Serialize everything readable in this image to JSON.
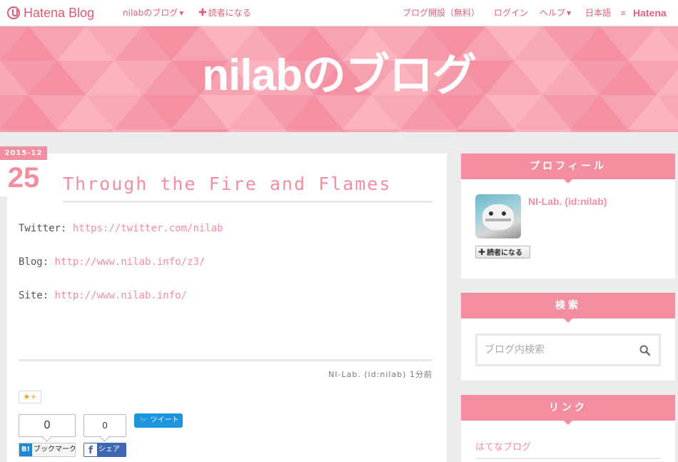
{
  "topbar": {
    "logo": "Hatena Blog",
    "blog_menu": "nilabのブログ",
    "subscribe": "読者になる",
    "start_blog": "ブログ開設（無料）",
    "login": "ログイン",
    "help": "ヘルプ",
    "language": "日本語",
    "hatena": "Hatena"
  },
  "header": {
    "blog_title": "nilabのブログ"
  },
  "entry": {
    "date_ym": "2015-12",
    "date_day": "25",
    "title": "Through the Fire and Flames",
    "lines": [
      {
        "label": "Twitter:",
        "url": "https://twitter.com/nilab"
      },
      {
        "label": "Blog:",
        "url": "http://www.nilab.info/z3/"
      },
      {
        "label": "Site:",
        "url": "http://www.nilab.info/"
      }
    ],
    "footer": "NI-Lab. (id:nilab) 1分前",
    "star_label": "★+",
    "hatebu_count": "0",
    "facebook_count": "0",
    "tweet_label": "ツイート",
    "hatebu_label": "ブックマーク",
    "hatebu_mark": "B!",
    "share_label": "シェア",
    "facebook_mark": "f"
  },
  "sidebar": {
    "profile": {
      "heading": "プロフィール",
      "name": "NI-Lab. (id:nilab)",
      "subscribe": "読者になる"
    },
    "search": {
      "heading": "検索",
      "placeholder": "ブログ内検索"
    },
    "links": {
      "heading": "リンク",
      "items": [
        "はてなブログ"
      ]
    }
  },
  "colors": {
    "accent": "#f38ea0",
    "header_bg": "#f697a8",
    "page_bg": "#ececec"
  },
  "icons": [
    "hatena-blog-logo-icon",
    "caret-down-icon",
    "plus-icon",
    "hatena-logo-icon",
    "search-icon",
    "twitter-bird-icon",
    "hatebu-icon",
    "facebook-icon",
    "star-icon"
  ]
}
